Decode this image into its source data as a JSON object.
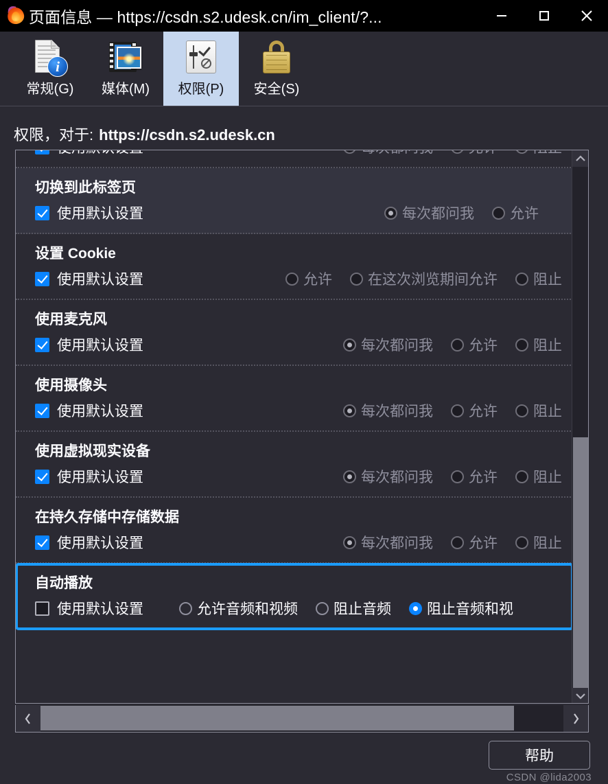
{
  "window": {
    "title": "页面信息 — https://csdn.s2.udesk.cn/im_client/?...",
    "logo_icon": "firefox-logo-icon",
    "minimize_label": "—",
    "maximize_label": "▢",
    "close_label": "✕"
  },
  "tabs": [
    {
      "label": "常规(G)",
      "icon": "document-info-icon",
      "selected": false
    },
    {
      "label": "媒体(M)",
      "icon": "media-photo-icon",
      "selected": false
    },
    {
      "label": "权限(P)",
      "icon": "permissions-sliders-icon",
      "selected": true
    },
    {
      "label": "安全(S)",
      "icon": "padlock-icon",
      "selected": false
    }
  ],
  "header": {
    "prefix": "权限，对于:",
    "host": "https://csdn.s2.udesk.cn"
  },
  "permissions": [
    {
      "title": "",
      "clipped": true,
      "default_label": "使用默认设置",
      "default_checked": true,
      "highlight": false,
      "options": [
        {
          "label": "每次都问我",
          "checked": true,
          "enabled": false
        },
        {
          "label": "允许",
          "checked": false,
          "enabled": false
        },
        {
          "label": "阻止",
          "checked": false,
          "enabled": false
        }
      ]
    },
    {
      "title": "切换到此标签页",
      "clipped": false,
      "default_label": "使用默认设置",
      "default_checked": true,
      "highlight": true,
      "shifted": true,
      "options": [
        {
          "label": "每次都问我",
          "checked": true,
          "enabled": false
        },
        {
          "label": "允许",
          "checked": false,
          "enabled": false
        }
      ]
    },
    {
      "title": "设置 Cookie",
      "clipped": false,
      "default_label": "使用默认设置",
      "default_checked": true,
      "highlight": false,
      "options": [
        {
          "label": "允许",
          "checked": false,
          "enabled": false
        },
        {
          "label": "在这次浏览期间允许",
          "checked": false,
          "enabled": false
        },
        {
          "label": "阻止",
          "checked": false,
          "enabled": false
        }
      ]
    },
    {
      "title": "使用麦克风",
      "clipped": false,
      "default_label": "使用默认设置",
      "default_checked": true,
      "highlight": false,
      "options": [
        {
          "label": "每次都问我",
          "checked": true,
          "enabled": false
        },
        {
          "label": "允许",
          "checked": false,
          "enabled": false
        },
        {
          "label": "阻止",
          "checked": false,
          "enabled": false
        }
      ]
    },
    {
      "title": "使用摄像头",
      "clipped": false,
      "default_label": "使用默认设置",
      "default_checked": true,
      "highlight": false,
      "options": [
        {
          "label": "每次都问我",
          "checked": true,
          "enabled": false
        },
        {
          "label": "允许",
          "checked": false,
          "enabled": false
        },
        {
          "label": "阻止",
          "checked": false,
          "enabled": false
        }
      ]
    },
    {
      "title": "使用虚拟现实设备",
      "clipped": false,
      "default_label": "使用默认设置",
      "default_checked": true,
      "highlight": false,
      "options": [
        {
          "label": "每次都问我",
          "checked": true,
          "enabled": false
        },
        {
          "label": "允许",
          "checked": false,
          "enabled": false
        },
        {
          "label": "阻止",
          "checked": false,
          "enabled": false
        }
      ]
    },
    {
      "title": "在持久存储中存储数据",
      "clipped": false,
      "default_label": "使用默认设置",
      "default_checked": true,
      "highlight": false,
      "options": [
        {
          "label": "每次都问我",
          "checked": true,
          "enabled": false
        },
        {
          "label": "允许",
          "checked": false,
          "enabled": false
        },
        {
          "label": "阻止",
          "checked": false,
          "enabled": false
        }
      ]
    },
    {
      "title": "自动播放",
      "clipped": false,
      "default_label": "使用默认设置",
      "default_checked": false,
      "highlight": false,
      "focused": true,
      "inline": true,
      "options": [
        {
          "label": "允许音频和视频",
          "checked": false,
          "enabled": true
        },
        {
          "label": "阻止音频",
          "checked": false,
          "enabled": true
        },
        {
          "label": "阻止音频和视",
          "checked": true,
          "enabled": true
        }
      ]
    }
  ],
  "scrollbars": {
    "vertical_up_icon": "chevron-up-icon",
    "vertical_down_icon": "chevron-down-icon",
    "horizontal_left_icon": "chevron-left-icon",
    "horizontal_right_icon": "chevron-right-icon"
  },
  "footer": {
    "help_label": "帮助",
    "watermark": "CSDN @lida2003"
  },
  "colors": {
    "window_bg": "#2b2a33",
    "titlebar_bg": "#000000",
    "accent_blue": "#0a84ff",
    "focus_blue": "#1b9cff",
    "selected_tab_bg": "#c6d7ef",
    "text": "#fbfbfe",
    "muted_text": "#8f8f9d"
  }
}
